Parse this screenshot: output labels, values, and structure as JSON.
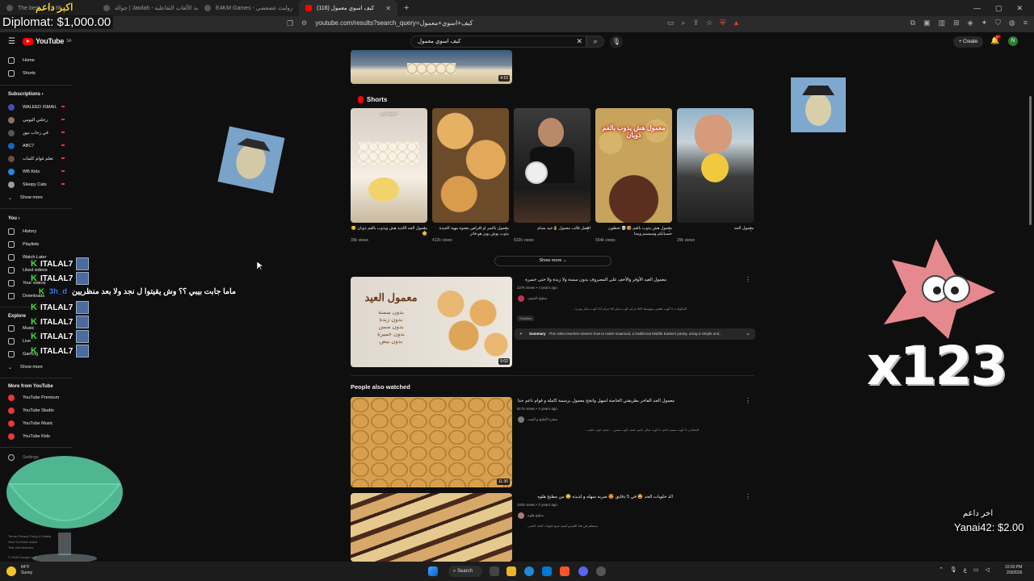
{
  "browser": {
    "tabs": [
      {
        "title": "The best ... for Ri",
        "active": false
      },
      {
        "title": "جوالة | Jawlah - منصة الألعاب التفاعلية",
        "active": false
      },
      {
        "title": "E4KM Games - روليت عصعصي",
        "active": false
      },
      {
        "title": "(116) كيف اسوي معمول - YouTube",
        "active": true
      }
    ],
    "url": "youtube.com/results?search_query=كيف+اسوي+معمول"
  },
  "youtube": {
    "logo": "YouTube",
    "region": "SA",
    "search_query": "كيف اسوي معمول",
    "create_label": "Create",
    "notif_count": "9+",
    "avatar_letter": "N"
  },
  "sidebar": {
    "main": [
      {
        "label": "Home",
        "icon": "home-icon"
      },
      {
        "label": "Shorts",
        "icon": "shorts-icon"
      }
    ],
    "subscriptions_title": "Subscriptions",
    "subscriptions": [
      {
        "label": "WALEED ISMAIL",
        "color": "#3f51b5"
      },
      {
        "label": "رحلتي اليومي",
        "color": "#8d6e63"
      },
      {
        "label": "في رحاب نيوز",
        "color": "#555555"
      },
      {
        "label": "ABC7",
        "color": "#1565c0"
      },
      {
        "label": "تعلم غوام كلمات",
        "color": "#6d4c41"
      },
      {
        "label": "WB Kids",
        "color": "#1e88e5"
      },
      {
        "label": "Sleepy Cats",
        "color": "#9e9e9e"
      }
    ],
    "show_more": "Show more",
    "you_title": "You",
    "you": [
      "History",
      "Playlists",
      "Watch Later",
      "Liked videos",
      "Your videos",
      "Downloads"
    ],
    "explore_title": "Explore",
    "explore": [
      "Music",
      "Live",
      "Gaming"
    ],
    "show_more_2": "Show more",
    "more_title": "More from YouTube",
    "more": [
      "YouTube Premium",
      "YouTube Studio",
      "YouTube Music",
      "YouTube Kids"
    ],
    "settings": "Settings",
    "footer": [
      "Terms  Privacy  Policy & Safety",
      "How YouTube works",
      "Test new features",
      "© 2026 Google LLC"
    ]
  },
  "results": {
    "top_video_duration": "4:15",
    "shorts_title": "Shorts",
    "shorts": [
      {
        "title": "معمول الجد اللذيذ هش ويذوب بالفم ذوبان 😋😋",
        "views": "39k views",
        "overlay": "عشوة ثمر"
      },
      {
        "title": "معمول بالتمر او اقراص بعجوة مهية الجيدة يذوب بوش يوبز هو فاتر",
        "views": "412k views",
        "overlay": ""
      },
      {
        "title": "افضل قالب معمول 👌جيد بسام",
        "views": "632k views",
        "overlay": ""
      },
      {
        "title": "معمول هش يذوب بالفم 😍💀 تحطون حسبانكم وسمسم ومدا",
        "views": "554k views",
        "overlay": "معمول هش يذوب بالفم ذوبان"
      },
      {
        "title": "معمول الجد",
        "views": "29k views",
        "overlay": ""
      }
    ],
    "shorts_show_more": "Show more",
    "video1": {
      "title": "معمول العيد الأوفر والأخف على المصروف بدون سمنة ولا زبدة ولا حتى خميرة",
      "meta": "227k views • 4 years ago",
      "channel": "مطبخ الشيف",
      "desc": "المكونات: 3 كوب طحين متوسط 400 غرام، كوب سكر 60 غرام 1/2 كوب سكر بودرة ...",
      "badge": "Subtitles",
      "duration": "5:02",
      "thumb_title": "معمول العيد",
      "thumb_lines": [
        "بدون سمنة",
        "بدون زبدة",
        "بدون سمن",
        "بدون خميرة",
        "بدون بيض"
      ],
      "summary_label": "Summary",
      "summary_text": "This video teaches viewers how to make maamoul, a traditional Middle Eastern pastry, using a simple and..."
    },
    "people_also_watched": "People also watched",
    "video2": {
      "title": "معمول الجد الفاخر بطريقتي الخاصة اسهل وانجح معمول برسمة كاملة و قوام ناعم جدا",
      "meta": "617k views • 4 years ago",
      "channel": "سفرة الطبخ و البيت",
      "desc": "المقادير: 3 كوب سميد ناعم، 1 كوب سكر ناعم، نصف كوب سمن ... نصف كوب حليب ...",
      "duration": "11:30"
    },
    "video3": {
      "title": "الذ حلويات الجد 🤩 في 5 دقايق 😍 ضربه سهله و لذيذه 🤤 من مطبخ هلوه",
      "meta": "104k views • 2 years ago",
      "channel": "مطبخ هلوه",
      "desc": "ستتعلم في هذا الفيديو كيفية صنع حلويات الجد بالتمر..."
    }
  },
  "overlays": {
    "top_left_donation": "Diplomat: $1,000.00",
    "top_left_arabic": "اكبر داعم",
    "bottom_right_arabic": "اخر داعم",
    "bottom_right_donation": "Yanai42: $2.00",
    "chat_user": "ITALAL7",
    "chat_lines_count": 7,
    "chat_message_user": "3h_d",
    "chat_message": "ماما جابت بيبي ؟؟ وش يقيتوا ل نجد ولا بعد منظريين",
    "combo": "x123"
  },
  "taskbar": {
    "search": "Search",
    "weather_temp": "84°F",
    "weather_text": "Sunny",
    "time": "10:50 PM",
    "date": "2/9/2026",
    "lang": "ع"
  }
}
